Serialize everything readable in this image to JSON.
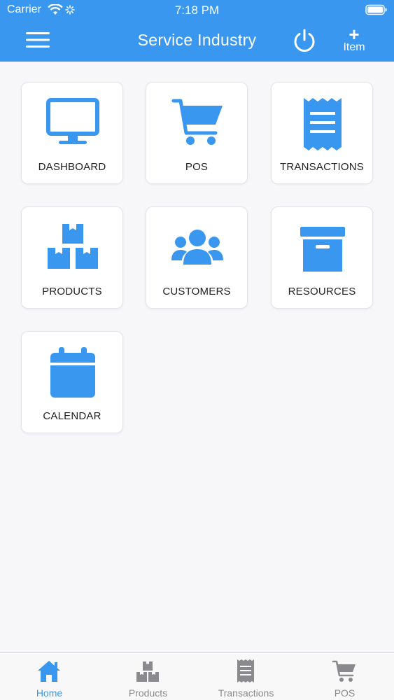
{
  "status_bar": {
    "carrier": "Carrier",
    "time": "7:18 PM"
  },
  "header": {
    "title": "Service Industry",
    "add_plus": "+",
    "add_label": "Item"
  },
  "tiles": [
    {
      "label": "DASHBOARD"
    },
    {
      "label": "POS"
    },
    {
      "label": "TRANSACTIONS"
    },
    {
      "label": "PRODUCTS"
    },
    {
      "label": "CUSTOMERS"
    },
    {
      "label": "RESOURCES"
    },
    {
      "label": "CALENDAR"
    }
  ],
  "tabbar": {
    "active": "Home",
    "items": [
      {
        "label": "Home",
        "icon": "home-icon"
      },
      {
        "label": "Products",
        "icon": "boxes-icon"
      },
      {
        "label": "Transactions",
        "icon": "receipt-icon"
      },
      {
        "label": "POS",
        "icon": "cart-icon"
      }
    ]
  },
  "colors": {
    "accent": "#3a97ef",
    "tab_inactive": "#8a8a8e",
    "background": "#f7f7f9"
  }
}
